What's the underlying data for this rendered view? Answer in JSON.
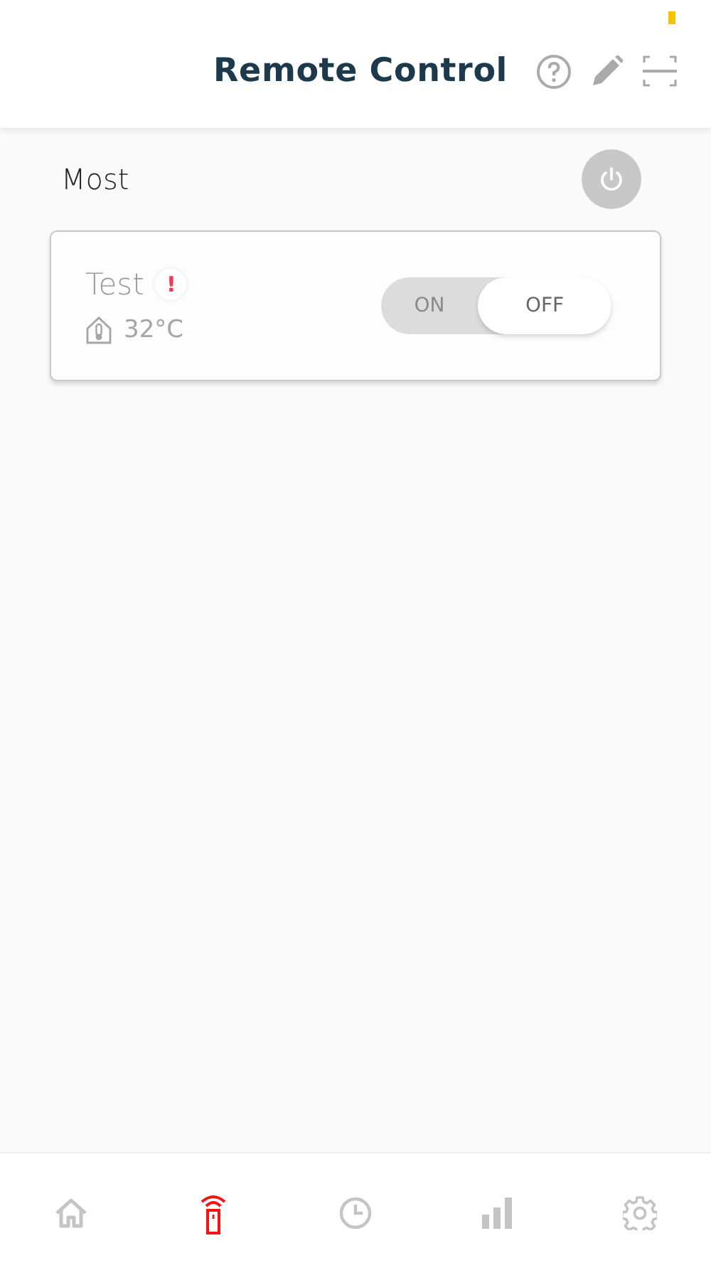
{
  "header": {
    "title": "Remote Control"
  },
  "section": {
    "title": "Most"
  },
  "devices": [
    {
      "name": "Test",
      "alert": "!",
      "temperature": "32°C",
      "on": false,
      "on_label": "ON",
      "off_label": "OFF"
    }
  ],
  "nav": [
    {
      "kind": "home",
      "selected": false
    },
    {
      "kind": "remote",
      "selected": true
    },
    {
      "kind": "history",
      "selected": false
    },
    {
      "kind": "stats",
      "selected": false
    },
    {
      "kind": "settings",
      "selected": false
    }
  ]
}
